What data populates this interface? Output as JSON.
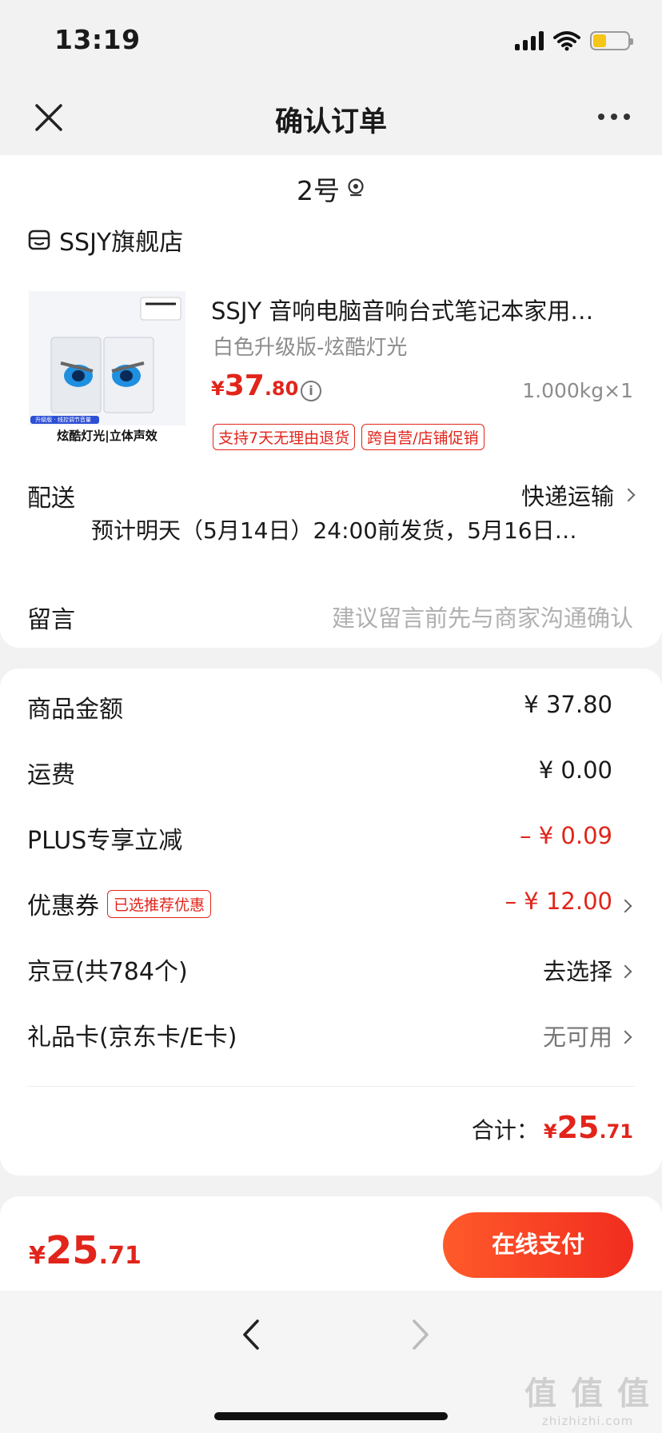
{
  "status_bar": {
    "time": "13:19"
  },
  "navbar": {
    "title": "确认订单"
  },
  "address": {
    "label": "2号"
  },
  "shop": {
    "name": "SSJY旗舰店"
  },
  "product": {
    "title": "SSJY 音响电脑音响台式笔记本家用…",
    "sku": "白色升级版-炫酷灯光",
    "price_currency": "¥",
    "price_int": "37",
    "price_dec": ".80",
    "weight_qty": "1.000kg×1",
    "tags": [
      "支持7天无理由退货",
      "跨自营/店铺促销"
    ],
    "image_caption": "炫酷灯光|立体声效",
    "image_badge": "升级版 · 线控调节音量"
  },
  "delivery": {
    "label": "配送",
    "method": "快递运输",
    "eta": "预计明天（5月14日）24:00前发货，5月16日…"
  },
  "message": {
    "label": "留言",
    "placeholder": "建议留言前先与商家沟通确认"
  },
  "fees": {
    "goods": {
      "label": "商品金额",
      "value": "¥ 37.80"
    },
    "shipping": {
      "label": "运费",
      "value": "¥ 0.00"
    },
    "plus": {
      "label": "PLUS专享立减",
      "value": "– ¥ 0.09"
    },
    "coupon": {
      "label": "优惠券",
      "tag": "已选推荐优惠",
      "value": "– ¥ 12.00"
    },
    "jingdou": {
      "label": "京豆(共784个)",
      "value": "去选择"
    },
    "giftcard": {
      "label": "礼品卡(京东卡/E卡)",
      "value": "无可用"
    }
  },
  "total": {
    "label": "合计：",
    "currency": "¥",
    "int": "25",
    "dec": ".71"
  },
  "paybar": {
    "currency": "¥",
    "int": "25",
    "dec": ".71",
    "button": "在线支付"
  },
  "watermark": {
    "main": "值 值 值",
    "sub": "zhizhizhi.com"
  },
  "colors": {
    "accent_red": "#e1251b",
    "button_gradient_start": "#ff5a2a",
    "button_gradient_end": "#f12d1f",
    "background": "#f2f2f2"
  }
}
